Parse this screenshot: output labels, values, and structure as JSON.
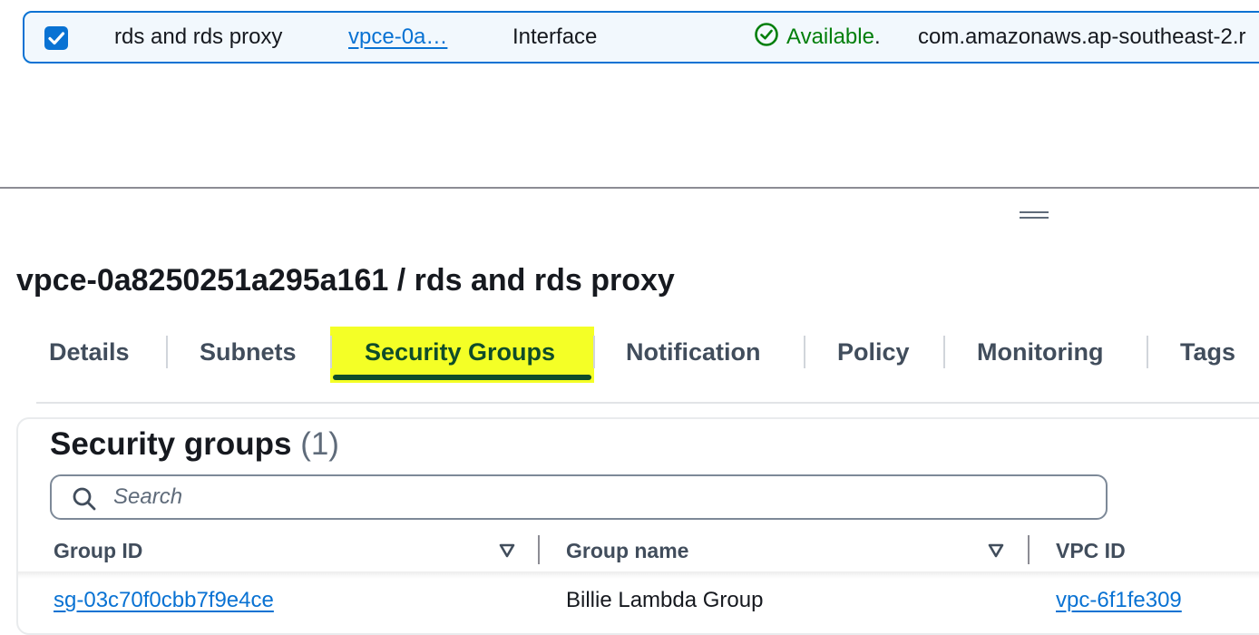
{
  "endpoint_row": {
    "name": "rds and rds proxy",
    "endpoint_id": "vpce-0a…",
    "type": "Interface",
    "status": "Available",
    "status_suffix": ".",
    "service_name": "com.amazonaws.ap-southeast-2.r"
  },
  "detail": {
    "title": "vpce-0a8250251a295a161 / rds and rds proxy"
  },
  "tabs": [
    {
      "label": "Details"
    },
    {
      "label": "Subnets"
    },
    {
      "label": "Security Groups",
      "active": true
    },
    {
      "label": "Notification"
    },
    {
      "label": "Policy"
    },
    {
      "label": "Monitoring"
    },
    {
      "label": "Tags"
    }
  ],
  "security_groups": {
    "heading": "Security groups",
    "count": "(1)",
    "search_placeholder": "Search",
    "columns": [
      "Group ID",
      "Group name",
      "VPC ID"
    ],
    "rows": [
      {
        "group_id": "sg-03c70f0cbb7f9e4ce",
        "group_name": "Billie Lambda Group",
        "vpc_id": "vpc-6f1fe309"
      }
    ]
  },
  "colors": {
    "link": "#0972d3",
    "success": "#037f0c",
    "highlight": "#f2ff00",
    "tab_underline": "#0f4c2a"
  },
  "icons": [
    "checkbox-checked-icon",
    "status-check-circle-icon",
    "drag-handle-icon",
    "search-icon",
    "sort-caret-down-icon"
  ]
}
